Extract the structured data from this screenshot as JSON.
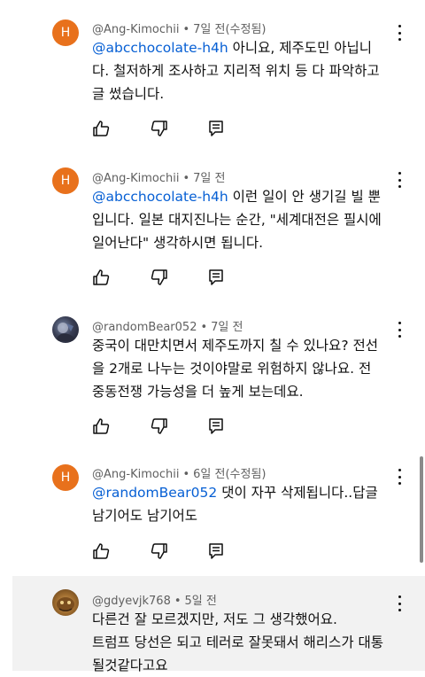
{
  "comments": [
    {
      "avatar_letter": "H",
      "handle": "@Ang-Kimochii",
      "separator": "•",
      "time": "7일 전(수정됨)",
      "mention": "@abcchocolate-h4h",
      "lines": [
        "아니요, 제주도민 아닙니",
        "다. 철저하게 조사하고 지리적 위치 등 다 파악하고",
        "글 썼습니다."
      ]
    },
    {
      "avatar_letter": "H",
      "handle": "@Ang-Kimochii",
      "separator": "•",
      "time": "7일 전",
      "mention": "@abcchocolate-h4h",
      "lines": [
        "이런 일이 안 생기길 빌 뿐",
        "입니다. 일본 대지진나는 순간, \"세계대전은 필시에",
        "일어난다\" 생각하시면 됩니다."
      ]
    },
    {
      "avatar_letter": "",
      "handle": "@randomBear052",
      "separator": "•",
      "time": "7일 전",
      "mention": "",
      "lines": [
        "중국이 대만치면서 제주도까지 칠 수 있나요? 전선",
        "을 2개로 나누는 것이야말로 위험하지 않나요. 전",
        "중동전쟁  가능성을 더 높게 보는데요."
      ]
    },
    {
      "avatar_letter": "H",
      "handle": "@Ang-Kimochii",
      "separator": "•",
      "time": "6일 전(수정됨)",
      "mention": "@randomBear052",
      "lines": [
        "댓이 자꾸 삭제됩니다..답글",
        "남기어도 남기어도"
      ]
    },
    {
      "avatar_letter": "",
      "handle": "@gdyevjk768",
      "separator": "•",
      "time": "5일 전",
      "mention": "",
      "lines": [
        "다른건 잘 모르겠지만, 저도 그 생각했어요.",
        "트럼프 당선은 되고 테러로 잘못돼서  해리스가 대통",
        "될것같다고요"
      ]
    }
  ],
  "icons": {
    "like": "thumbs-up-icon",
    "dislike": "thumbs-down-icon",
    "reply": "comment-reply-icon",
    "menu": "more-vertical-icon"
  },
  "colors": {
    "avatar_orange": "#e8711c",
    "mention_blue": "#065fd4",
    "meta_gray": "#606060",
    "highlight_bg": "#f2f2f2"
  }
}
